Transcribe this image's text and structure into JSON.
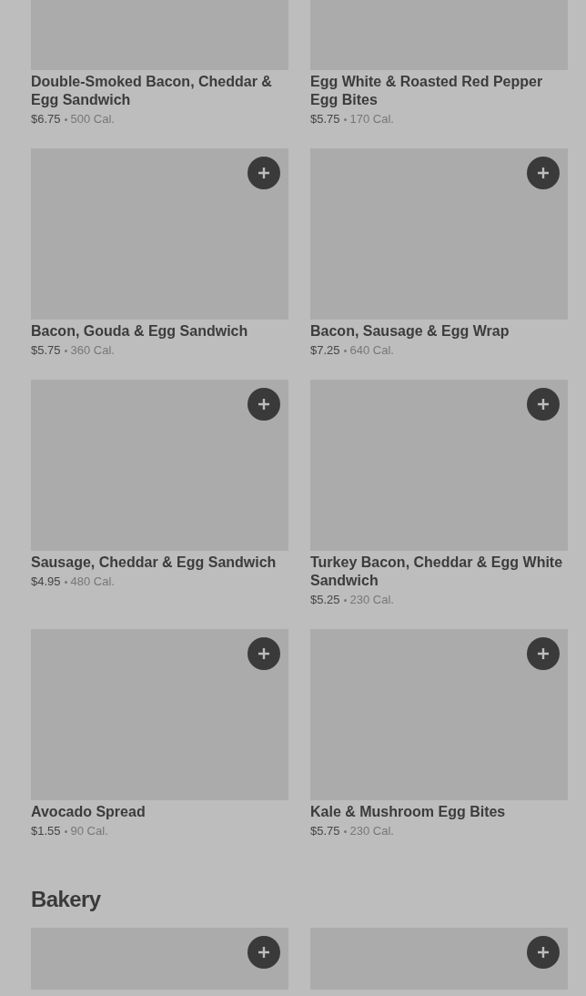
{
  "sections": [
    {
      "items": [
        {
          "name": "Double-Smoked Bacon, Cheddar & Egg Sandwich",
          "price": "$6.75",
          "calories": "500 Cal."
        },
        {
          "name": "Egg White & Roasted Red Pepper Egg Bites",
          "price": "$5.75",
          "calories": "170 Cal."
        },
        {
          "name": "Bacon, Gouda & Egg Sandwich",
          "price": "$5.75",
          "calories": "360 Cal."
        },
        {
          "name": "Bacon, Sausage & Egg Wrap",
          "price": "$7.25",
          "calories": "640 Cal."
        },
        {
          "name": "Sausage, Cheddar & Egg Sandwich",
          "price": "$4.95",
          "calories": "480 Cal."
        },
        {
          "name": "Turkey Bacon, Cheddar & Egg White Sandwich",
          "price": "$5.25",
          "calories": "230 Cal."
        },
        {
          "name": "Avocado Spread",
          "price": "$1.55",
          "calories": "90 Cal."
        },
        {
          "name": "Kale & Mushroom Egg Bites",
          "price": "$5.75",
          "calories": "230 Cal."
        }
      ]
    },
    {
      "heading": "Bakery"
    }
  ]
}
